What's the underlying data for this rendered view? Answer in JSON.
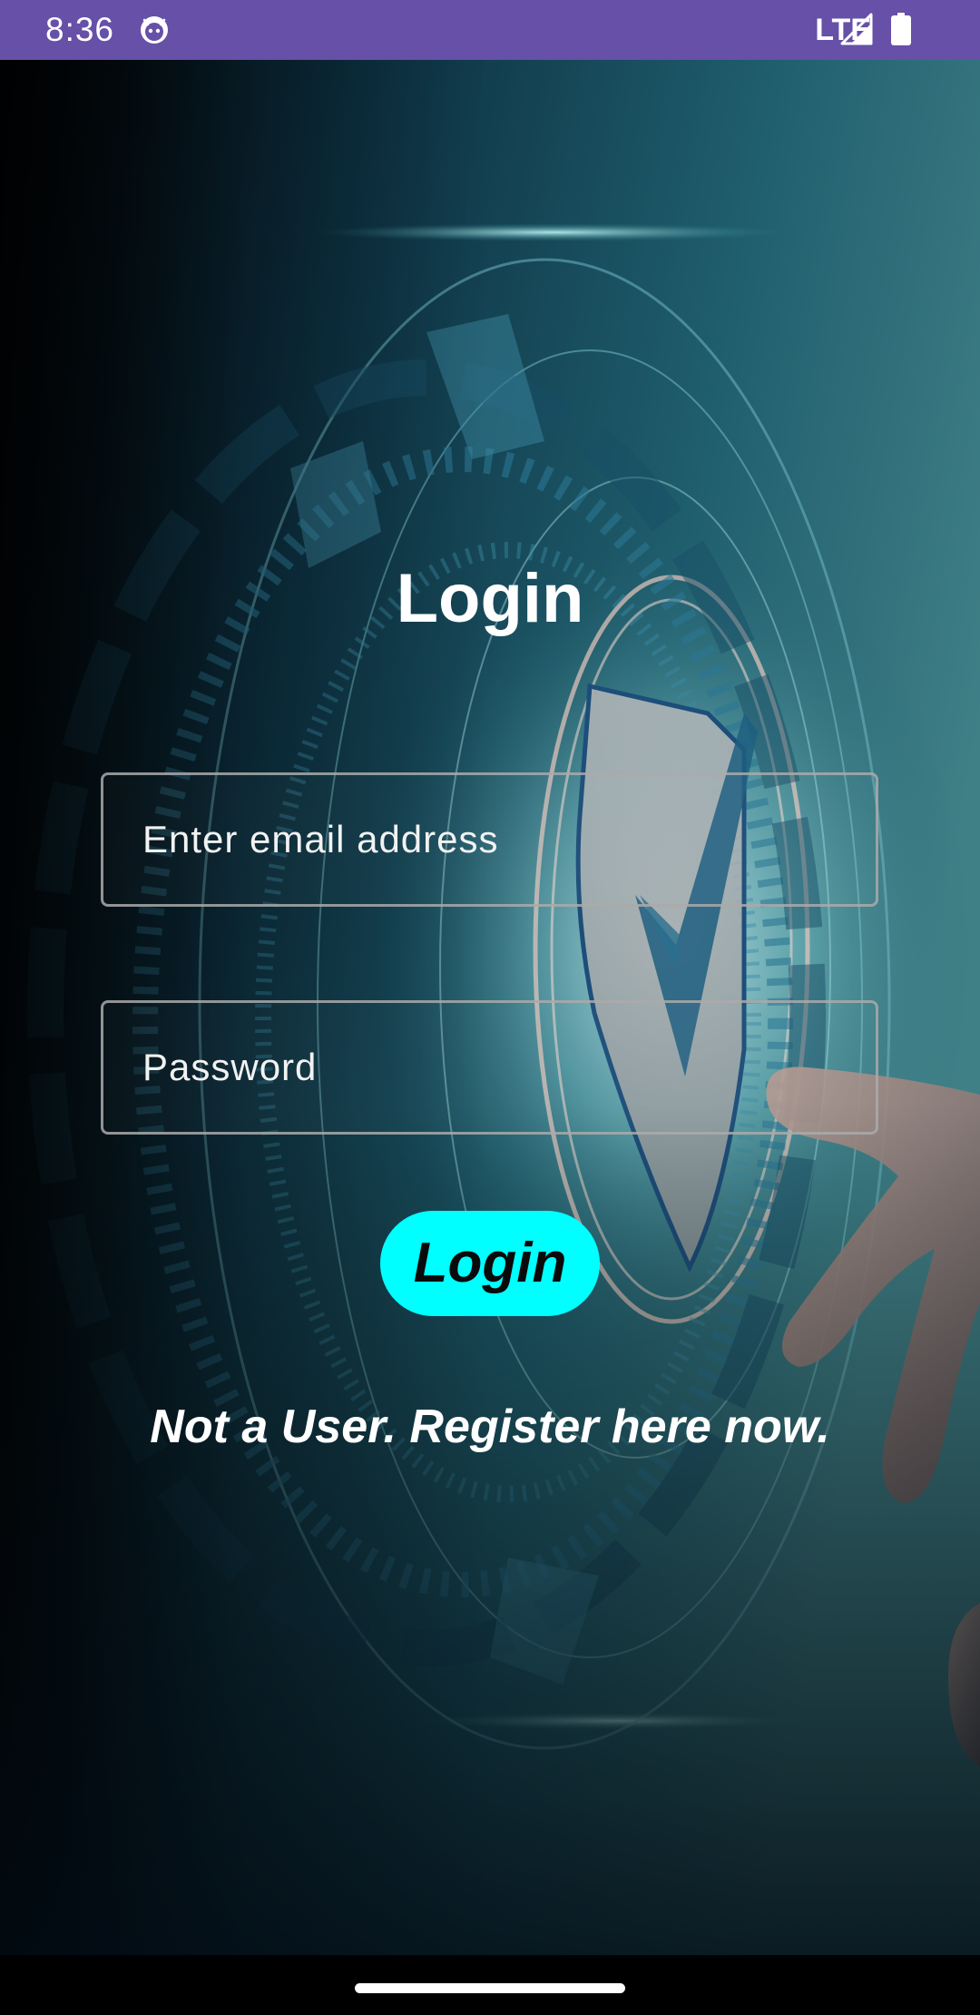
{
  "status_bar": {
    "time": "8:36",
    "network": "LTE",
    "app_icon": "android-debug-icon",
    "signal_icon": "cell-signal-icon",
    "battery_icon": "battery-icon",
    "color": "#6650a8"
  },
  "background": {
    "image": "security-shield-checkmark-hud-with-hand"
  },
  "login": {
    "title": "Login",
    "email_placeholder": "Enter email address",
    "email_value": "",
    "password_placeholder": "Password",
    "password_value": "",
    "button_label": "Login",
    "register_link": "Not a User. Register here now.",
    "button_color": "#00ffff"
  },
  "nav_bar": {
    "home_handle": "gesture-home-handle"
  }
}
